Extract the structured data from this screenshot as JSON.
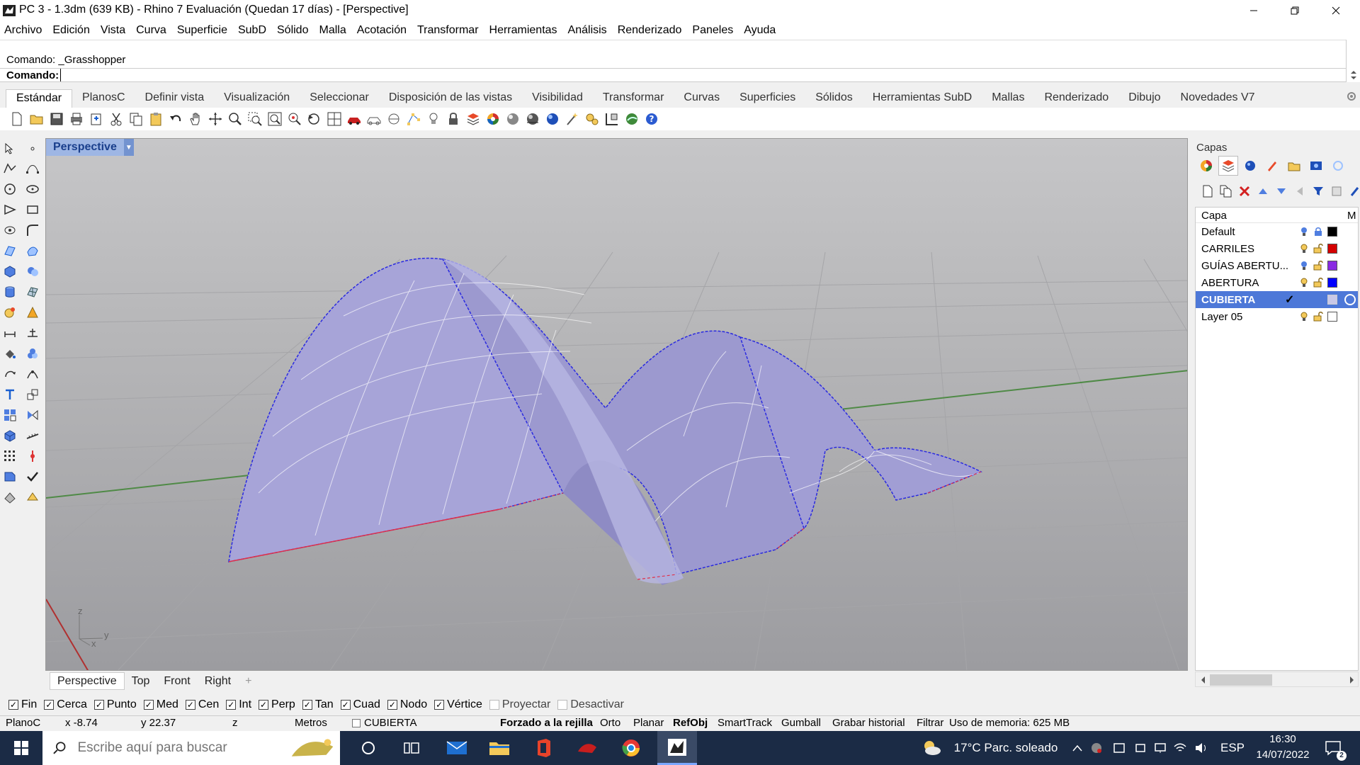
{
  "window": {
    "title": "PC 3 - 1.3dm (639 KB) - Rhino 7 Evaluación (Quedan 17 días) - [Perspective]"
  },
  "menu": [
    "Archivo",
    "Edición",
    "Vista",
    "Curva",
    "Superficie",
    "SubD",
    "Sólido",
    "Malla",
    "Acotación",
    "Transformar",
    "Herramientas",
    "Análisis",
    "Renderizado",
    "Paneles",
    "Ayuda"
  ],
  "command": {
    "history": "Comando: _Grasshopper",
    "prompt": "Comando:",
    "value": ""
  },
  "ribbon_tabs": [
    "Estándar",
    "PlanosC",
    "Definir vista",
    "Visualización",
    "Seleccionar",
    "Disposición de las vistas",
    "Visibilidad",
    "Transformar",
    "Curvas",
    "Superficies",
    "Sólidos",
    "Herramientas SubD",
    "Mallas",
    "Renderizado",
    "Dibujo",
    "Novedades V7"
  ],
  "viewport": {
    "name": "Perspective",
    "axes": {
      "z": "z",
      "y": "y",
      "x": "x"
    }
  },
  "view_tabs": [
    "Perspective",
    "Top",
    "Front",
    "Right"
  ],
  "osnaps": [
    {
      "label": "Fin",
      "checked": true
    },
    {
      "label": "Cerca",
      "checked": true
    },
    {
      "label": "Punto",
      "checked": true
    },
    {
      "label": "Med",
      "checked": true
    },
    {
      "label": "Cen",
      "checked": true
    },
    {
      "label": "Int",
      "checked": true
    },
    {
      "label": "Perp",
      "checked": true
    },
    {
      "label": "Tan",
      "checked": true
    },
    {
      "label": "Cuad",
      "checked": true
    },
    {
      "label": "Nodo",
      "checked": true
    },
    {
      "label": "Vértice",
      "checked": true
    },
    {
      "label": "Proyectar",
      "checked": false
    },
    {
      "label": "Desactivar",
      "checked": false
    }
  ],
  "status": {
    "cplane": "PlanoC",
    "x": "x -8.74",
    "y": "y 22.37",
    "z": "z",
    "units": "Metros",
    "layer": "CUBIERTA",
    "grid_snap": "Forzado a la rejilla",
    "ortho": "Orto",
    "planar": "Planar",
    "osnap": "RefObj",
    "smarttrack": "SmartTrack",
    "gumball": "Gumball",
    "history": "Grabar historial",
    "filter": "Filtrar",
    "memory": "Uso de memoria: 625 MB"
  },
  "layers_panel": {
    "title": "Capas",
    "header": "Capa",
    "header_m": "M",
    "layers": [
      {
        "name": "Default",
        "color": "#000000",
        "current": false
      },
      {
        "name": "CARRILES",
        "color": "#d40000",
        "current": false
      },
      {
        "name": "GUÍAS ABERTU...",
        "color": "#8a2be2",
        "current": false
      },
      {
        "name": "ABERTURA",
        "color": "#0000ff",
        "current": false
      },
      {
        "name": "CUBIERTA",
        "color": "#ffffff",
        "current": true
      },
      {
        "name": "Layer 05",
        "color": "#ffffff",
        "current": false
      }
    ]
  },
  "taskbar": {
    "search_placeholder": "Escribe aquí para buscar",
    "weather": "17°C  Parc. soleado",
    "lang": "ESP",
    "time": "16:30",
    "date": "14/07/2022",
    "notif_count": "2"
  },
  "colors": {
    "accent": "#4d78d8",
    "surface": "#a9a6d6",
    "viewport_title_bg": "#9eb6e4",
    "taskbar_bg": "#1b2b45"
  }
}
